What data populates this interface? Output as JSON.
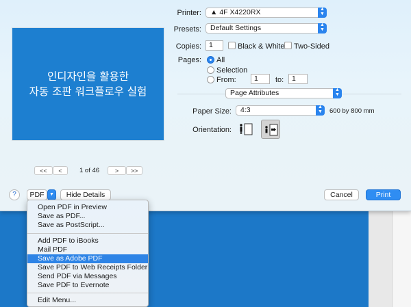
{
  "preview": {
    "line1": "인디자인을 활용한",
    "line2": "자동 조판 워크플로우 실험"
  },
  "pager": {
    "first": "<<",
    "prev": "<",
    "page_text": "1 of 46",
    "next": ">",
    "last": ">>"
  },
  "printer": {
    "label": "Printer:",
    "value": "4F X4220RX"
  },
  "presets": {
    "label": "Presets:",
    "value": "Default Settings"
  },
  "copies": {
    "label": "Copies:",
    "value": "1",
    "bw_label": "Black & White",
    "two_sided_label": "Two-Sided"
  },
  "pages": {
    "label": "Pages:",
    "all": "All",
    "selection": "Selection",
    "from": "From:",
    "from_value": "1",
    "to": "to:",
    "to_value": "1",
    "selected": "All"
  },
  "section": {
    "value": "Page Attributes"
  },
  "paper": {
    "label": "Paper Size:",
    "value": "4:3",
    "dims": "600 by 800 mm"
  },
  "orientation": {
    "label": "Orientation:",
    "selected": "landscape"
  },
  "footer": {
    "help": "?",
    "pdf": "PDF",
    "hide_details": "Hide Details",
    "cancel": "Cancel",
    "print": "Print"
  },
  "pdf_menu": {
    "items": [
      "Open PDF in Preview",
      "Save as PDF...",
      "Save as PostScript...",
      "Add PDF to iBooks",
      "Mail PDF",
      "Save as Adobe PDF",
      "Save PDF to Web Receipts Folder",
      "Send PDF via Messages",
      "Save PDF to Evernote",
      "Edit Menu..."
    ],
    "highlighted": "Save as Adobe PDF"
  },
  "colors": {
    "accent": "#2a84ee",
    "preview_bg": "#1d7fd0",
    "menu_highlight": "#2e84e6"
  }
}
